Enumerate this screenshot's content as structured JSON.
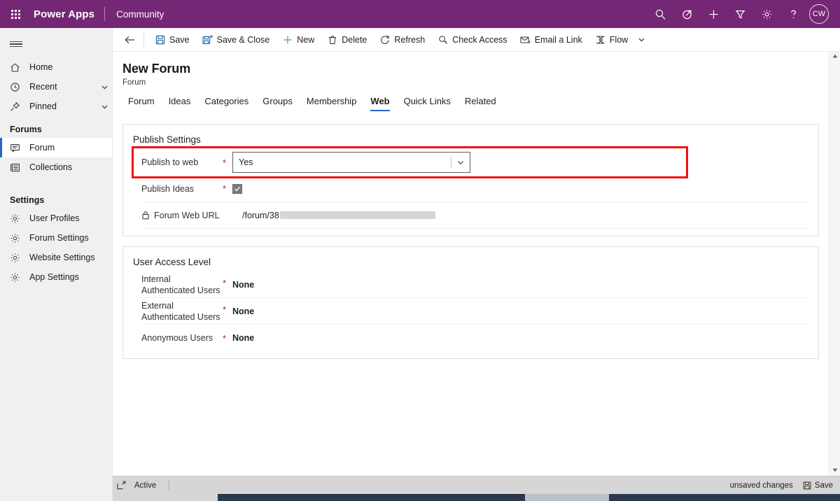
{
  "topbar": {
    "waffle_label": "app-launcher",
    "brand": "Power Apps",
    "app_name": "Community",
    "icons": [
      {
        "name": "search-icon",
        "label": "Search"
      },
      {
        "name": "assistant-icon",
        "label": "Assistant"
      },
      {
        "name": "plus-icon",
        "label": "New"
      },
      {
        "name": "filter-icon",
        "label": "Filter"
      },
      {
        "name": "gear-icon",
        "label": "Settings"
      },
      {
        "name": "help-icon",
        "label": "Help"
      }
    ],
    "avatar_initials": "CW"
  },
  "sidebar": {
    "hamburger_label": "Site Map",
    "items": [
      {
        "label": "Home",
        "icon": "home-icon",
        "expandable": false
      },
      {
        "label": "Recent",
        "icon": "clock-icon",
        "expandable": true
      },
      {
        "label": "Pinned",
        "icon": "pin-icon",
        "expandable": true
      }
    ],
    "groups": [
      {
        "title": "Forums",
        "items": [
          {
            "label": "Forum",
            "icon": "forum-icon",
            "selected": true
          },
          {
            "label": "Collections",
            "icon": "collections-icon",
            "selected": false
          }
        ]
      },
      {
        "title": "Settings",
        "items": [
          {
            "label": "User Profiles",
            "icon": "gear-icon",
            "selected": false
          },
          {
            "label": "Forum Settings",
            "icon": "gear-icon",
            "selected": false
          },
          {
            "label": "Website Settings",
            "icon": "gear-icon",
            "selected": false
          },
          {
            "label": "App Settings",
            "icon": "gear-icon",
            "selected": false
          }
        ]
      }
    ]
  },
  "commandbar": {
    "back_label": "Back",
    "commands": [
      {
        "label": "Save",
        "icon": "save-icon"
      },
      {
        "label": "Save & Close",
        "icon": "save-close-icon"
      },
      {
        "label": "New",
        "icon": "plus-icon"
      },
      {
        "label": "Delete",
        "icon": "trash-icon"
      },
      {
        "label": "Refresh",
        "icon": "refresh-icon"
      },
      {
        "label": "Check Access",
        "icon": "key-icon"
      },
      {
        "label": "Email a Link",
        "icon": "email-icon"
      },
      {
        "label": "Flow",
        "icon": "flow-icon"
      }
    ],
    "overflow_label": "More commands"
  },
  "record": {
    "title": "New Forum",
    "entity": "Forum"
  },
  "tabs": [
    {
      "label": "Forum",
      "active": false
    },
    {
      "label": "Ideas",
      "active": false
    },
    {
      "label": "Categories",
      "active": false
    },
    {
      "label": "Groups",
      "active": false
    },
    {
      "label": "Membership",
      "active": false
    },
    {
      "label": "Web",
      "active": true
    },
    {
      "label": "Quick Links",
      "active": false
    },
    {
      "label": "Related",
      "active": false
    }
  ],
  "publish_settings": {
    "title": "Publish Settings",
    "publish_to_web": {
      "label": "Publish to web",
      "required": "*",
      "value": "Yes",
      "highlighted": true
    },
    "publish_ideas": {
      "label": "Publish Ideas",
      "required": "*",
      "checked": true
    },
    "forum_web_url": {
      "label": "Forum Web URL",
      "icon": "lock-icon",
      "value": "/forum/38",
      "redacted": true
    }
  },
  "user_access_level": {
    "title": "User Access Level",
    "rows": [
      {
        "label_line1": "Internal",
        "label_line2": "Authenticated Users",
        "required": "*",
        "value": "None"
      },
      {
        "label_line1": "External",
        "label_line2": "Authenticated Users",
        "required": "*",
        "value": "None"
      },
      {
        "label_line1": "Anonymous Users",
        "label_line2": "",
        "required": "*",
        "value": "None"
      }
    ]
  },
  "footer": {
    "expand_label": "expand-icon",
    "status": "Active",
    "unsaved": "unsaved changes",
    "save_label": "Save"
  },
  "colors": {
    "brand_purple": "#742774",
    "accent_blue": "#2266cc",
    "required_red": "#a4262c",
    "highlight_red": "#ee1111",
    "sidebar_bg": "#f0f0f0",
    "footer_bg": "#d6d6d6"
  }
}
